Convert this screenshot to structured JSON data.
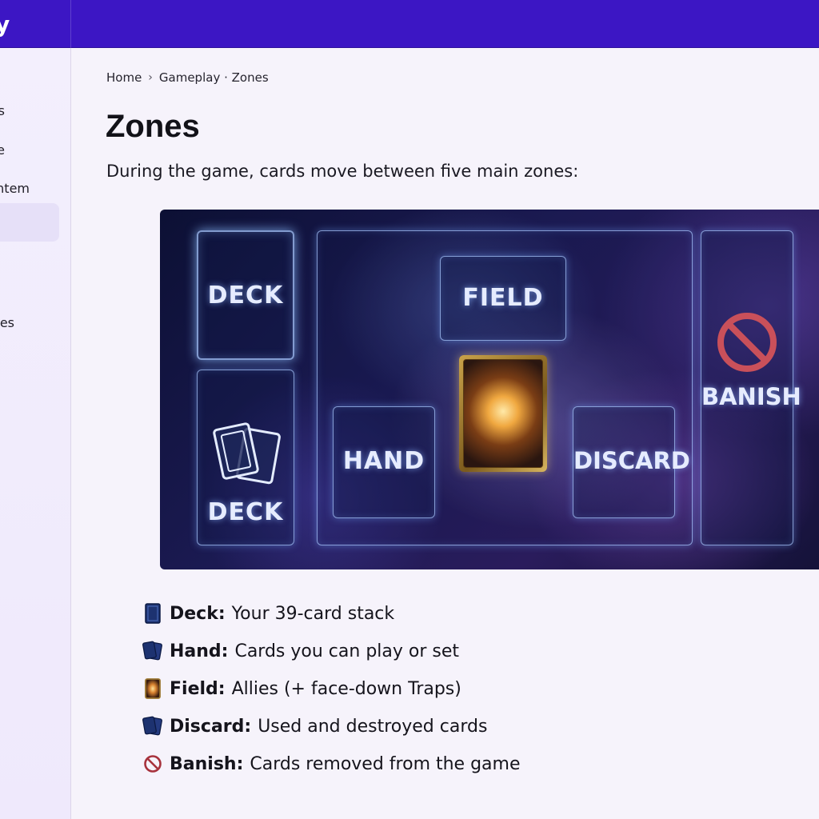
{
  "topbar": {
    "brand_tail": "y"
  },
  "sidebar": {
    "items": [
      {
        "label": "s"
      },
      {
        "label": "e"
      },
      {
        "label": "ntem"
      },
      {
        "label": "es"
      }
    ]
  },
  "breadcrumb": {
    "home": "Home",
    "separator": "›",
    "current": "Gameplay · Zones"
  },
  "page": {
    "title": "Zones",
    "intro": "During the game, cards move between five main zones:"
  },
  "board": {
    "labels": {
      "deck_top": "DECK",
      "deck_bottom": "DECK",
      "field": "FIELD",
      "hand": "HAND",
      "discard": "DISCARD",
      "banish": "BANISH"
    },
    "colors": {
      "glow": "#aac8ff",
      "banish_red": "#c9505a",
      "card_gold": "#c9a24a"
    }
  },
  "legend": [
    {
      "icon": "deck-icon",
      "term": "Deck:",
      "desc": "Your 39-card stack"
    },
    {
      "icon": "hand-icon",
      "term": "Hand:",
      "desc": "Cards you can play or set"
    },
    {
      "icon": "field-card-icon",
      "term": "Field:",
      "desc": "Allies (+ face-down Traps)"
    },
    {
      "icon": "discard-icon",
      "term": "Discard:",
      "desc": "Used and destroyed cards"
    },
    {
      "icon": "banish-icon",
      "term": "Banish:",
      "desc": "Cards removed from the game"
    }
  ]
}
